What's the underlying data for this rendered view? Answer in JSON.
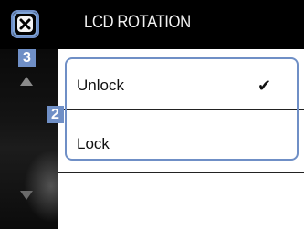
{
  "header": {
    "title": "LCD ROTATION",
    "close_icon": "close-icon"
  },
  "options": [
    {
      "label": "Unlock",
      "selected": true
    },
    {
      "label": "Lock",
      "selected": false
    }
  ],
  "check_glyph": "✔",
  "callouts": {
    "close": "3",
    "list": "2"
  },
  "colors": {
    "callout": "#6f8fc6",
    "header_bg": "#000000",
    "list_bg": "#ffffff"
  }
}
